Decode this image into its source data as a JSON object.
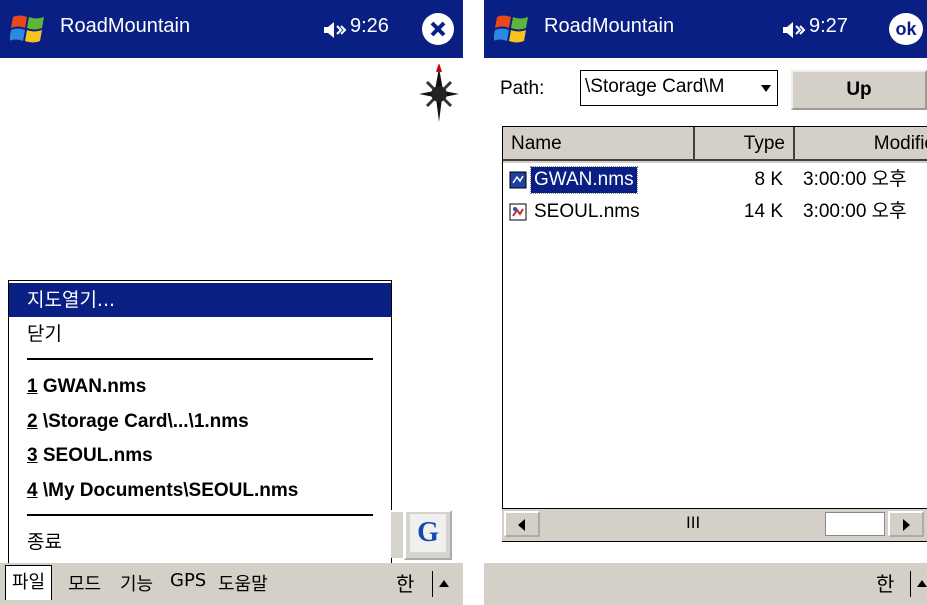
{
  "left_screen": {
    "app_title": "RoadMountain",
    "clock": "9:26",
    "icons": {
      "start": "windows-flag-icon",
      "volume": "speaker-icon",
      "close": "close-icon",
      "compass": "compass-icon"
    },
    "file_menu": {
      "items": [
        {
          "label": "지도열기...",
          "selected": true
        },
        {
          "label": "닫기"
        }
      ],
      "recent_files": [
        {
          "num": "1",
          "path": "GWAN.nms"
        },
        {
          "num": "2",
          "path": "\\Storage Card\\...\\1.nms"
        },
        {
          "num": "3",
          "path": "SEOUL.nms"
        },
        {
          "num": "4",
          "path": "\\My Documents\\SEOUL.nms"
        }
      ],
      "exit_label": "종료"
    },
    "g_button_label": "G",
    "menubar": [
      "파일",
      "모드",
      "기능",
      "GPS",
      "도움말"
    ],
    "input_icon_label": "한"
  },
  "right_screen": {
    "app_title": "RoadMountain",
    "clock": "9:27",
    "ok_label": "ok",
    "path_label": "Path:",
    "path_value": "\\Storage Card\\M",
    "up_label": "Up",
    "columns": [
      "Name",
      "Type",
      "Modifie"
    ],
    "files": [
      {
        "name": "GWAN.nms",
        "size": "8 K",
        "modified": "3:00:00 오후",
        "selected": true
      },
      {
        "name": "SEOUL.nms",
        "size": "14 K",
        "modified": "3:00:00 오후",
        "selected": false
      }
    ],
    "scroll_grip": "III",
    "input_icon_label": "한"
  },
  "colors": {
    "titlebar": "#0a1f84",
    "menubar": "#d4d0c8",
    "selection": "#0a1f84"
  }
}
